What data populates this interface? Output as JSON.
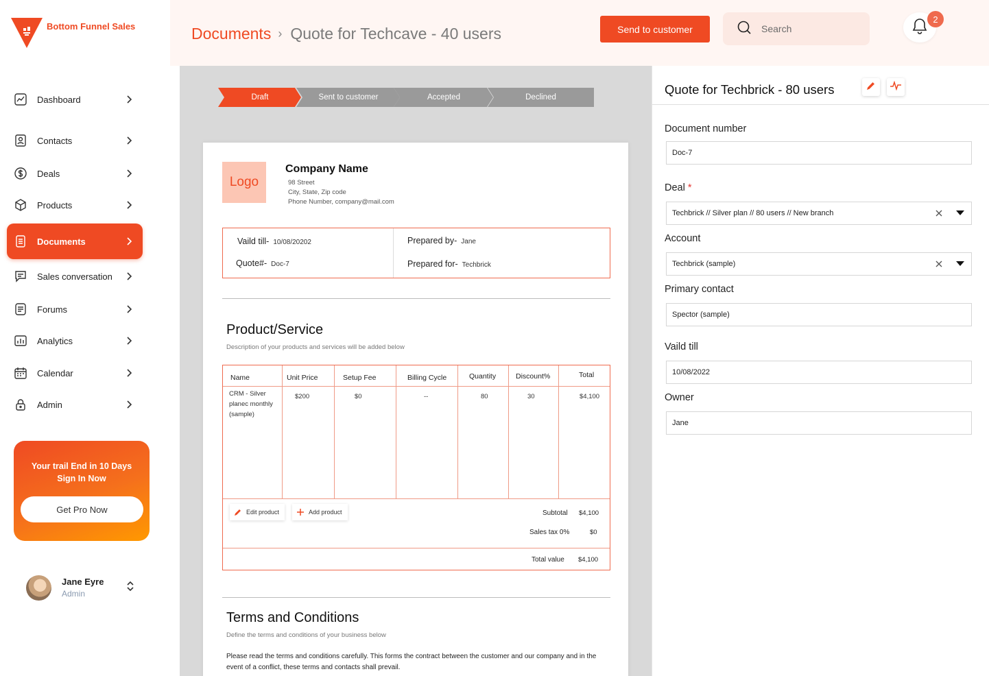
{
  "brand": {
    "name": "Bottom Funnel Sales",
    "accent": "#ef4a23"
  },
  "sidebar": {
    "items": [
      {
        "label": "Dashboard",
        "icon": "dashboard-icon"
      },
      {
        "label": "Contacts",
        "icon": "contacts-icon"
      },
      {
        "label": "Deals",
        "icon": "dollar-icon"
      },
      {
        "label": "Products",
        "icon": "box-icon"
      },
      {
        "label": "Documents",
        "icon": "document-icon",
        "active": true
      },
      {
        "label": "Sales conversation",
        "icon": "chat-icon"
      },
      {
        "label": "Forums",
        "icon": "forum-icon"
      },
      {
        "label": "Analytics",
        "icon": "bar-chart-icon"
      },
      {
        "label": "Calendar",
        "icon": "calendar-icon"
      },
      {
        "label": "Admin",
        "icon": "lock-icon"
      }
    ],
    "promo": {
      "line1": "Your trail End in 10 Days",
      "line2": "Sign In Now",
      "button": "Get Pro Now"
    },
    "user": {
      "name": "Jane Eyre",
      "role": "Admin"
    }
  },
  "header": {
    "breadcrumb_root": "Documents",
    "breadcrumb_current": "Quote for Techcave - 40 users",
    "send_button": "Send to customer",
    "search_placeholder": "Search",
    "notification_count": "2"
  },
  "steps": [
    "Draft",
    "Sent to customer",
    "Accepted",
    "Declined"
  ],
  "document": {
    "logo": "Logo",
    "company_name": "Company Name",
    "address_line1": "98 Street",
    "address_line2": "City, State, Zip code",
    "address_line3": "Phone Number, company@mail.com",
    "valid_till_label": "Vaild till-",
    "valid_till_value": "10/08/20202",
    "quote_label": "Quote#-",
    "quote_value": "Doc-7",
    "prepared_by_label": "Prepared by-",
    "prepared_by_value": "Jane",
    "prepared_for_label": "Prepared for-",
    "prepared_for_value": "Techbrick",
    "product_title": "Product/Service",
    "product_sub": "Description of your products and services will be added below",
    "table": {
      "headers": [
        "Name",
        "Unit Price",
        "Setup Fee",
        "Billing Cycle",
        "Quantity",
        "Discount%",
        "Total"
      ],
      "row": {
        "name_line1": "CRM - Silver",
        "name_line2": "planec monthly",
        "name_line3": "(sample)",
        "unit_price": "$200",
        "setup_fee": "$0",
        "billing_cycle": "--",
        "quantity": "80",
        "discount": "30",
        "total": "$4,100"
      }
    },
    "edit_product": "Edit product",
    "add_product": "Add product",
    "subtotal_label": "Subtotal",
    "subtotal_value": "$4,100",
    "tax_label": "Sales tax 0%",
    "tax_value": "$0",
    "total_label": "Total value",
    "total_value": "$4,100",
    "terms_title": "Terms and Conditions",
    "terms_sub": "Define the terms and conditions of your business below",
    "terms_text": "Please read the terms and conditions carefully. This forms the contract between the customer and our company and in the event of a conflict, these terms and contacts shall prevail."
  },
  "panel": {
    "title": "Quote for Techbrick - 80 users",
    "fields": {
      "document_number_label": "Document number",
      "document_number_value": "Doc-7",
      "deal_label": "Deal",
      "deal_required": "*",
      "deal_value": "Techbrick // Silver plan // 80 users // New branch",
      "account_label": "Account",
      "account_value": "Techbrick (sample)",
      "primary_contact_label": "Primary contact",
      "primary_contact_value": "Spector (sample)",
      "valid_till_label": "Vaild till",
      "valid_till_value": "10/08/2022",
      "owner_label": "Owner",
      "owner_value": "Jane"
    }
  }
}
